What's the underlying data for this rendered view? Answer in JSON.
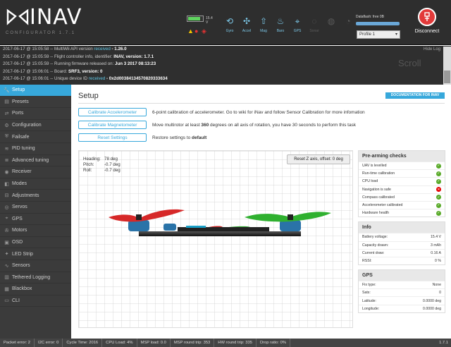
{
  "app": {
    "brand": "INAV",
    "subtitle": "CONFIGURATOR  1.7.1"
  },
  "topbar": {
    "battery_voltage": "15.4 V",
    "battery_fill": 0.85,
    "sensors": [
      {
        "name": "gyro",
        "label": "Gyro",
        "state": "on"
      },
      {
        "name": "accel",
        "label": "Accel",
        "state": "on"
      },
      {
        "name": "mag",
        "label": "Mag",
        "state": "on"
      },
      {
        "name": "baro",
        "label": "Baro",
        "state": "on"
      },
      {
        "name": "gps",
        "label": "GPS",
        "state": "on"
      },
      {
        "name": "sonar",
        "label": "Sonar",
        "state": "off"
      },
      {
        "name": "airspeed",
        "label": "",
        "state": "off"
      },
      {
        "name": "opflow",
        "label": "",
        "state": "off"
      }
    ],
    "dataflash_label": "Dataflash: free 0B",
    "profile_select": "Profile 1",
    "disconnect_label": "Disconnect"
  },
  "log": {
    "lines": [
      {
        "time": "2017-06-17 @ 15:05:58",
        "text": " -- MultiWii API version ",
        "green": "received",
        "tail": " - 1.26.0"
      },
      {
        "time": "2017-06-17 @ 15:05:59",
        "text": " -- Flight controller info, identifier: ",
        "green": "",
        "tail": "INAV, version: 1.7.1"
      },
      {
        "time": "2017-06-17 @ 15:05:59",
        "text": " -- Running firmware released on: ",
        "green": "",
        "tail": "Jun 3 2017 08:13:23"
      },
      {
        "time": "2017-06-17 @ 15:06:01",
        "text": " -- Board: ",
        "green": "",
        "tail": "SRF3, version: 0"
      },
      {
        "time": "2017-06-17 @ 15:06:01",
        "text": " -- Unique device ID ",
        "green": "received",
        "tail": " - 0x2d00384134570820333634"
      }
    ],
    "hide_label": "Hide Log",
    "scroll_label": "Scroll"
  },
  "sidebar": {
    "items": [
      {
        "key": "setup",
        "label": "Setup",
        "icon": "wrench-icon",
        "glyph": "🔧",
        "active": true
      },
      {
        "key": "presets",
        "label": "Presets",
        "icon": "presets-icon",
        "glyph": "▤",
        "active": false
      },
      {
        "key": "ports",
        "label": "Ports",
        "icon": "ports-icon",
        "glyph": "⇄",
        "active": false
      },
      {
        "key": "configuration",
        "label": "Configuration",
        "icon": "gear-icon",
        "glyph": "⚙",
        "active": false
      },
      {
        "key": "failsafe",
        "label": "Failsafe",
        "icon": "failsafe-icon",
        "glyph": "⛨",
        "active": false
      },
      {
        "key": "pid",
        "label": "PID tuning",
        "icon": "pid-icon",
        "glyph": "≋",
        "active": false
      },
      {
        "key": "advanced",
        "label": "Advanced tuning",
        "icon": "advanced-icon",
        "glyph": "≣",
        "active": false
      },
      {
        "key": "receiver",
        "label": "Receiver",
        "icon": "receiver-icon",
        "glyph": "◉",
        "active": false
      },
      {
        "key": "modes",
        "label": "Modes",
        "icon": "modes-icon",
        "glyph": "◧",
        "active": false
      },
      {
        "key": "adjustments",
        "label": "Adjustments",
        "icon": "adjustments-icon",
        "glyph": "⊟",
        "active": false
      },
      {
        "key": "servos",
        "label": "Servos",
        "icon": "servos-icon",
        "glyph": "◎",
        "active": false
      },
      {
        "key": "gps",
        "label": "GPS",
        "icon": "gps-icon",
        "glyph": "⌖",
        "active": false
      },
      {
        "key": "motors",
        "label": "Motors",
        "icon": "motors-icon",
        "glyph": "✇",
        "active": false
      },
      {
        "key": "osd",
        "label": "OSD",
        "icon": "osd-icon",
        "glyph": "▣",
        "active": false
      },
      {
        "key": "ledstrip",
        "label": "LED Strip",
        "icon": "led-strip-icon",
        "glyph": "✦",
        "active": false
      },
      {
        "key": "sensors",
        "label": "Sensors",
        "icon": "sensors-icon",
        "glyph": "∿",
        "active": false
      },
      {
        "key": "tethered",
        "label": "Tethered Logging",
        "icon": "tethered-logging-icon",
        "glyph": "▥",
        "active": false
      },
      {
        "key": "blackbox",
        "label": "Blackbox",
        "icon": "blackbox-icon",
        "glyph": "▦",
        "active": false
      },
      {
        "key": "cli",
        "label": "CLI",
        "icon": "cli-icon",
        "glyph": "▭",
        "active": false
      }
    ]
  },
  "setup": {
    "title": "Setup",
    "doc_button": "DOCUMENTATION FOR INAV",
    "calibrate_accel_label": "Calibrate Accelerometer",
    "calibrate_accel_desc": "6-point calibration of accelerometer. Go to wiki for iNav and follow Sensor Calibration for more infomation",
    "calibrate_mag_label": "Calibrate Magnetometer",
    "calibrate_mag_desc_pre": "Move multirotor at least ",
    "calibrate_mag_desc_bold": "360",
    "calibrate_mag_desc_post": " degrees on all axis of rotation, you have 30 seconds to perform this task",
    "reset_label": "Reset Settings",
    "reset_desc_pre": "Restore settings to ",
    "reset_desc_bold": "default"
  },
  "attitude": {
    "heading_label": "Heading:",
    "heading": "78 deg",
    "pitch_label": "Pitch:",
    "pitch": "-0.7 deg",
    "roll_label": "Roll:",
    "roll": "-0.7 deg",
    "reset_z_label": "Reset Z axis, offset: 0 deg"
  },
  "prearm": {
    "title": "Pre-arming checks",
    "items": [
      {
        "label": "UAV is levelled",
        "ok": true
      },
      {
        "label": "Run-time calibration",
        "ok": true
      },
      {
        "label": "CPU load",
        "ok": true
      },
      {
        "label": "Navigation is safe",
        "ok": false
      },
      {
        "label": "Compass calibrated",
        "ok": true
      },
      {
        "label": "Accelerometer calibrated",
        "ok": true
      },
      {
        "label": "Hardware health",
        "ok": true
      }
    ]
  },
  "info": {
    "title": "Info",
    "rows": [
      {
        "label": "Battery voltage:",
        "value": "15.4 V"
      },
      {
        "label": "Capacity drawn:",
        "value": "3 mAh"
      },
      {
        "label": "Current draw:",
        "value": "0.16 A"
      },
      {
        "label": "RSSI:",
        "value": "0 %"
      }
    ]
  },
  "gps": {
    "title": "GPS",
    "rows": [
      {
        "label": "Fix type:",
        "value": "None"
      },
      {
        "label": "Sats:",
        "value": "0"
      },
      {
        "label": "Latitude:",
        "value": "0.0000 deg"
      },
      {
        "label": "Longitude:",
        "value": "0.0000 deg"
      }
    ]
  },
  "status": {
    "items": [
      "Packet error: 2",
      "I2C error: 0",
      "Cycle Time: 2016",
      "CPU Load: 4%",
      "MSP load: 0.0",
      "MSP round trip: 353",
      "HW round trip: 335",
      "Drop ratio: 0%"
    ],
    "version": "1.7.1"
  },
  "colors": {
    "accent": "#37a8db",
    "ok": "#59aa29",
    "error": "#e60000",
    "disconnect": "#e23a3a"
  }
}
